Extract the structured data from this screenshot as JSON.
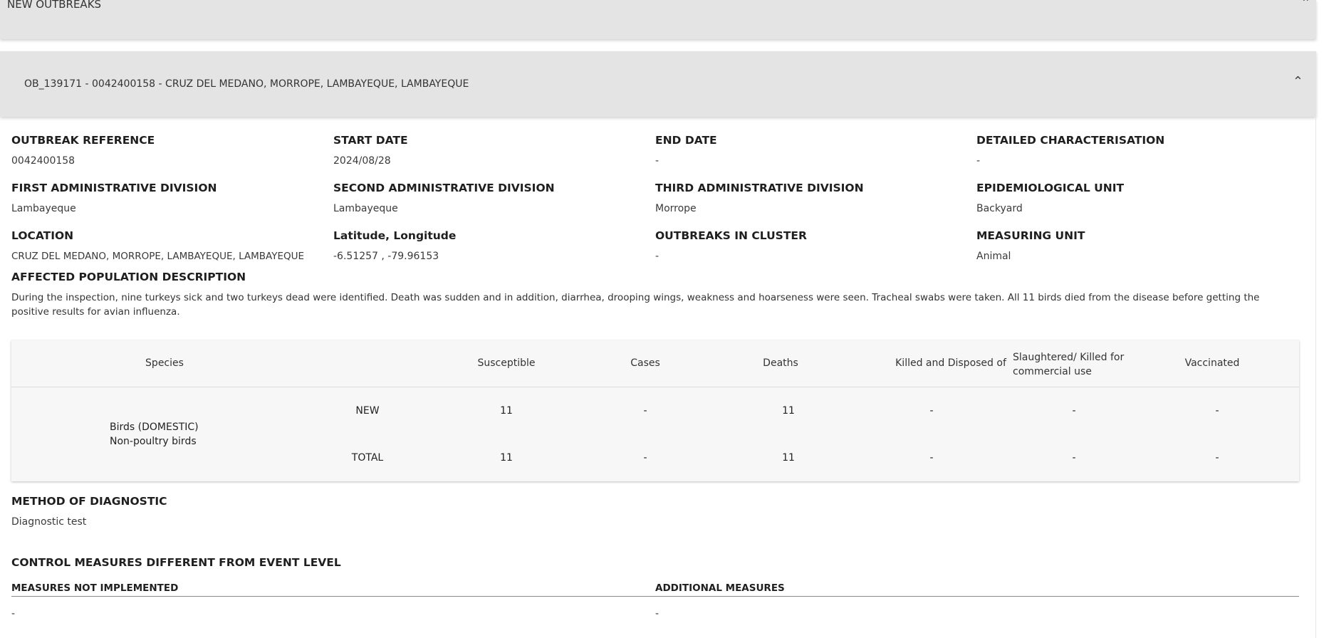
{
  "top_panel": {
    "title": "NEW OUTBREAKS"
  },
  "outbreak_panel": {
    "title": "OB_139171 - 0042400158 - CRUZ DEL MEDANO, MORROPE, LAMBAYEQUE, LAMBAYEQUE"
  },
  "fields": {
    "outbreak_reference": {
      "label": "OUTBREAK REFERENCE",
      "value": "0042400158"
    },
    "start_date": {
      "label": "START DATE",
      "value": "2024/08/28"
    },
    "end_date": {
      "label": "END DATE",
      "value": "-"
    },
    "detailed_characterisation": {
      "label": "DETAILED CHARACTERISATION",
      "value": "-"
    },
    "first_admin_division": {
      "label": "FIRST ADMINISTRATIVE DIVISION",
      "value": "Lambayeque"
    },
    "second_admin_division": {
      "label": "SECOND ADMINISTRATIVE DIVISION",
      "value": "Lambayeque"
    },
    "third_admin_division": {
      "label": "THIRD ADMINISTRATIVE DIVISION",
      "value": "Morrope"
    },
    "epidemiological_unit": {
      "label": "EPIDEMIOLOGICAL UNIT",
      "value": "Backyard"
    },
    "location": {
      "label": "LOCATION",
      "value": "CRUZ DEL MEDANO, MORROPE, LAMBAYEQUE, LAMBAYEQUE"
    },
    "lat_long": {
      "label": "Latitude, Longitude",
      "value": "-6.51257 , -79.96153"
    },
    "outbreaks_in_cluster": {
      "label": "OUTBREAKS IN CLUSTER",
      "value": "-"
    },
    "measuring_unit": {
      "label": "MEASURING UNIT",
      "value": "Animal"
    }
  },
  "affected_population": {
    "label": "AFFECTED POPULATION DESCRIPTION",
    "text": "During the inspection, nine turkeys sick and two turkeys dead were identified. Death was sudden and in addition, diarrhea, drooping wings, weakness and hoarseness were seen. Tracheal swabs were taken. All 11 birds died from the disease before getting the positive results for avian influenza."
  },
  "table": {
    "headers": {
      "species": "Species",
      "susceptible": "Susceptible",
      "cases": "Cases",
      "deaths": "Deaths",
      "killed": "Killed and Disposed of",
      "slaughtered": "Slaughtered/ Killed for commercial use",
      "vaccinated": "Vaccinated"
    },
    "species_line1": "Birds (DOMESTIC)",
    "species_line2": "Non-poultry birds",
    "rows": [
      {
        "type": "NEW",
        "susceptible": "11",
        "cases": "-",
        "deaths": "11",
        "killed": "-",
        "slaughtered": "-",
        "vaccinated": "-"
      },
      {
        "type": "TOTAL",
        "susceptible": "11",
        "cases": "-",
        "deaths": "11",
        "killed": "-",
        "slaughtered": "-",
        "vaccinated": "-"
      }
    ]
  },
  "method_of_diagnostic": {
    "label": "METHOD OF DIAGNOSTIC",
    "value": "Diagnostic test"
  },
  "control_measures": {
    "label": "CONTROL MEASURES DIFFERENT FROM EVENT LEVEL",
    "not_implemented_label": "MEASURES NOT IMPLEMENTED",
    "not_implemented_value": "-",
    "additional_label": "ADDITIONAL MEASURES",
    "additional_value": "-"
  }
}
